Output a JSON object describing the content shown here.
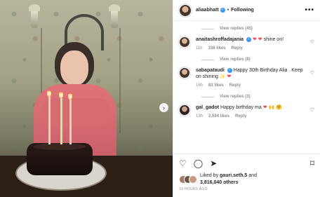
{
  "post": {
    "author": "aliaabhatt",
    "follow_status": "Following",
    "more_icon": "more-horizontal-icon"
  },
  "comments": [
    {
      "type": "replies",
      "label": "View replies (45)"
    },
    {
      "type": "comment",
      "user": "anaitashroffadajania",
      "text": "shine on!",
      "emoji": "❤ ❤",
      "age": "11h",
      "likes": "338 likes",
      "reply": "Reply"
    },
    {
      "type": "replies",
      "label": "View replies (8)"
    },
    {
      "type": "comment",
      "user": "sabapataudi",
      "text": "Happy 30th Birthday Alia . Keep on shining ✨",
      "emoji": "❤",
      "age": "16h",
      "likes": "83 likes",
      "reply": "Reply"
    },
    {
      "type": "replies",
      "label": "View replies (3)"
    },
    {
      "type": "comment",
      "user": "gal_gadot",
      "text": "Happy birthday ma",
      "emoji": "❤ 🙌 🤗",
      "age": "13h",
      "likes": "2,594 likes",
      "reply": "Reply"
    }
  ],
  "footer": {
    "liked_prefix": "Liked by",
    "liked_user": "gauri.seth.5",
    "liked_and": "and",
    "liked_others": "3,816,040 others",
    "time_ago": "19 HOURS AGO"
  },
  "icons": {
    "like": "heart-icon",
    "comment": "comment-icon",
    "share": "share-icon",
    "save": "bookmark-icon",
    "next": "chevron-right-icon"
  }
}
